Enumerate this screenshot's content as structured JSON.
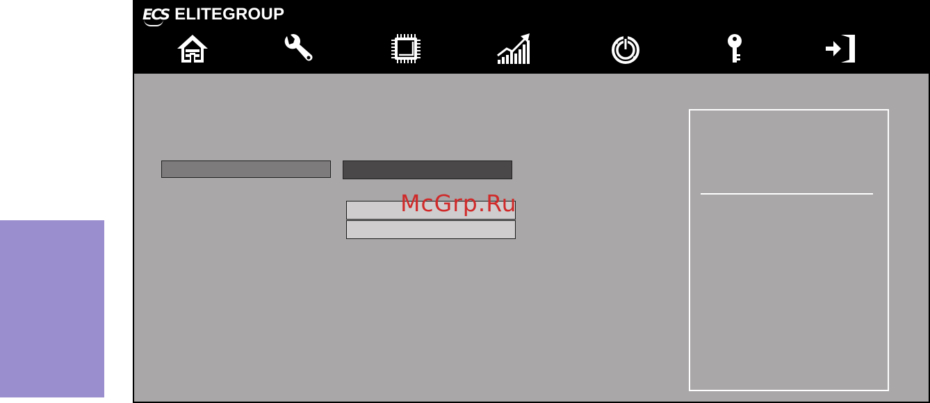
{
  "brand": {
    "mark": "ECS",
    "name": "ELITEGROUP"
  },
  "nav": {
    "items": [
      {
        "icon": "home-icon"
      },
      {
        "icon": "wrench-icon"
      },
      {
        "icon": "chip-icon"
      },
      {
        "icon": "performance-chart-icon"
      },
      {
        "icon": "power-icon"
      },
      {
        "icon": "key-icon"
      },
      {
        "icon": "exit-icon"
      }
    ]
  },
  "watermark": {
    "text": "McGrp.Ru"
  },
  "colors": {
    "topbar": "#000000",
    "panel": "#a9a7a8",
    "side_block": "#9b8ecf",
    "field_dark": "#4a4849",
    "field_mid": "#7d7b7c",
    "option": "#cfcdce",
    "watermark": "#d02a2a"
  }
}
